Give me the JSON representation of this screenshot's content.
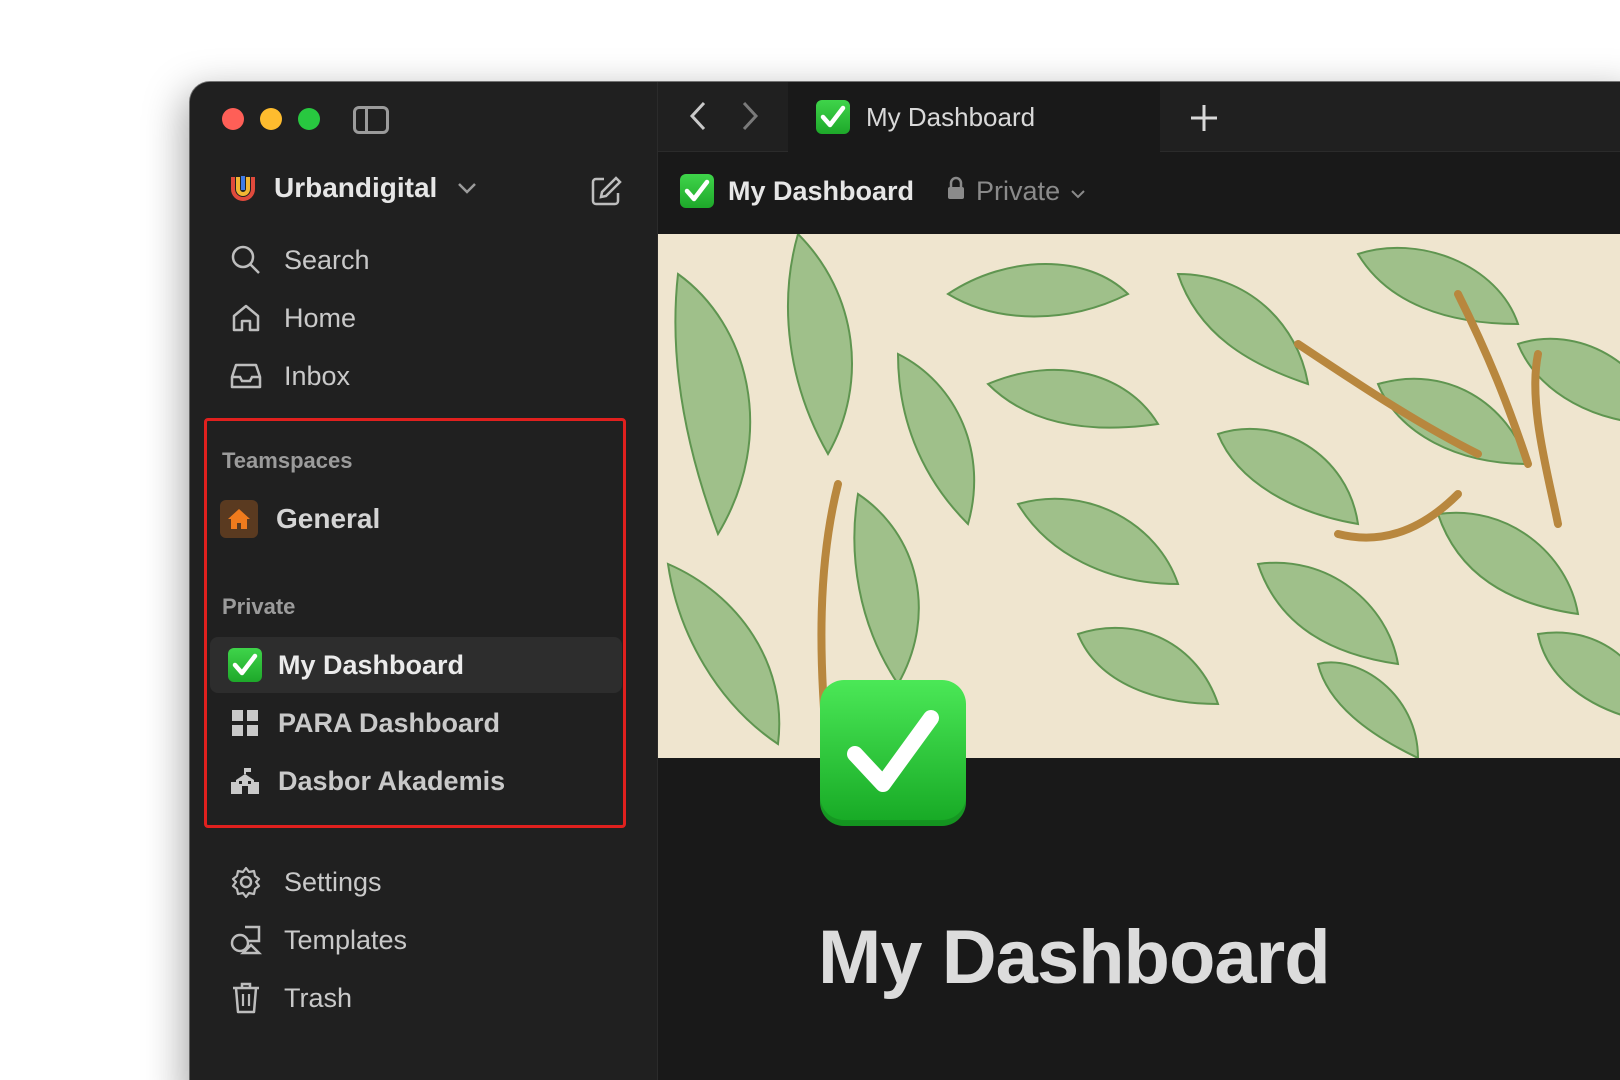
{
  "window": {
    "workspace_name": "Urbandigital",
    "tab_title": "My Dashboard"
  },
  "sidebar": {
    "nav": [
      {
        "label": "Search",
        "icon": "search-icon"
      },
      {
        "label": "Home",
        "icon": "home-icon"
      },
      {
        "label": "Inbox",
        "icon": "inbox-icon"
      }
    ],
    "teamspaces_label": "Teamspaces",
    "teamspaces": [
      {
        "label": "General",
        "icon": "house-icon"
      }
    ],
    "private_label": "Private",
    "private_pages": [
      {
        "label": "My Dashboard",
        "icon": "check-icon",
        "active": true
      },
      {
        "label": "PARA Dashboard",
        "icon": "grid-icon"
      },
      {
        "label": "Dasbor Akademis",
        "icon": "school-icon"
      }
    ],
    "footer": [
      {
        "label": "Settings",
        "icon": "gear-icon"
      },
      {
        "label": "Templates",
        "icon": "templates-icon"
      },
      {
        "label": "Trash",
        "icon": "trash-icon"
      }
    ]
  },
  "breadcrumb": {
    "title": "My Dashboard",
    "visibility": "Private"
  },
  "page": {
    "title": "My Dashboard"
  },
  "colors": {
    "highlight": "#e0201e",
    "check_green": "#28c840"
  }
}
